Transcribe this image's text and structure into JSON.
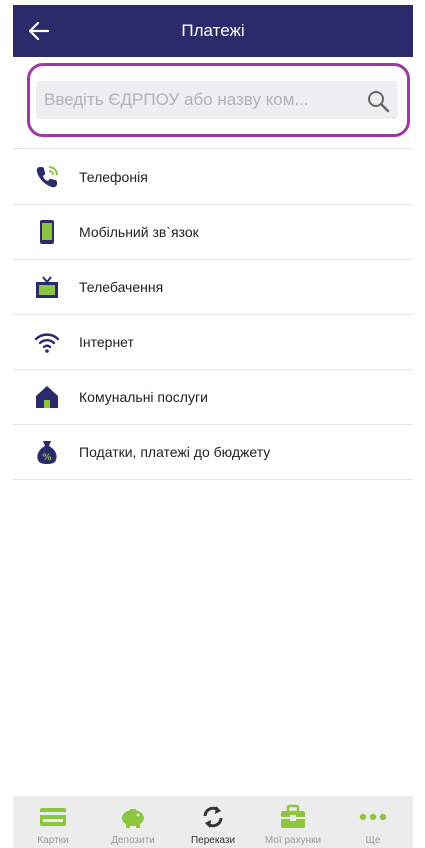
{
  "header": {
    "title": "Платежі"
  },
  "search": {
    "placeholder": "Введіть ЄДРПОУ або назву ком..."
  },
  "menu": {
    "items": [
      {
        "label": "Телефонія",
        "icon": "phone-icon"
      },
      {
        "label": "Мобільний зв`язок",
        "icon": "smartphone-icon"
      },
      {
        "label": "Телебачення",
        "icon": "tv-icon"
      },
      {
        "label": "Інтернет",
        "icon": "wifi-icon"
      },
      {
        "label": "Комунальні послуги",
        "icon": "house-icon"
      },
      {
        "label": "Податки, платежі до бюджету",
        "icon": "money-bag-icon"
      }
    ]
  },
  "tabbar": {
    "tabs": [
      {
        "label": "Картки",
        "icon": "card-icon"
      },
      {
        "label": "Депозити",
        "icon": "piggy-bank-icon"
      },
      {
        "label": "Перекази",
        "icon": "transfer-icon",
        "active": true
      },
      {
        "label": "Мої рахунки",
        "icon": "briefcase-icon"
      },
      {
        "label": "Ще",
        "icon": "more-icon"
      }
    ]
  },
  "colors": {
    "header_bg": "#2b2a6b",
    "accent_green": "#8cc63f",
    "dark_icon": "#2b2a6b",
    "search_border": "#9b3aa0"
  }
}
